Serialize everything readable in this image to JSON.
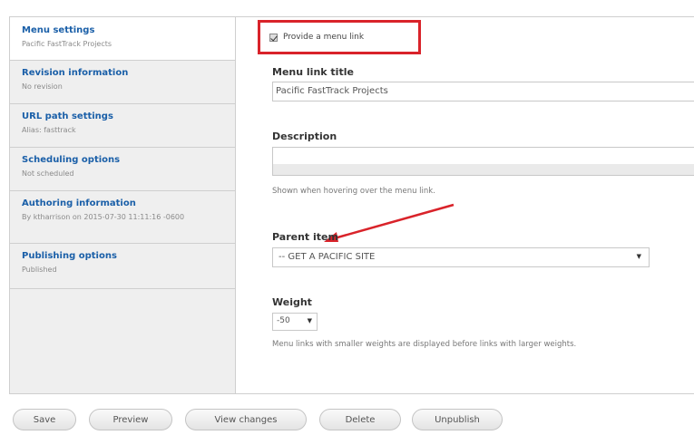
{
  "sidebar": {
    "tabs": [
      {
        "title": "Menu settings",
        "summary": "Pacific FastTrack Projects"
      },
      {
        "title": "Revision information",
        "summary": "No revision"
      },
      {
        "title": "URL path settings",
        "summary": "Alias: fasttrack"
      },
      {
        "title": "Scheduling options",
        "summary": "Not scheduled"
      },
      {
        "title": "Authoring information",
        "summary": "By ktharrison on 2015-07-30 11:11:16 -0600"
      },
      {
        "title": "Publishing options",
        "summary": "Published"
      }
    ]
  },
  "menu": {
    "provide_link_label": "Provide a menu link",
    "provide_link_checked": true,
    "link_title_label": "Menu link title",
    "link_title_value": "Pacific FastTrack Projects",
    "description_label": "Description",
    "description_value": "",
    "description_help": "Shown when hovering over the menu link.",
    "parent_label": "Parent item",
    "parent_value": "-- GET A PACIFIC SITE",
    "weight_label": "Weight",
    "weight_value": "-50",
    "weight_help": "Menu links with smaller weights are displayed before links with larger weights."
  },
  "buttons": {
    "save": "Save",
    "preview": "Preview",
    "view_changes": "View changes",
    "delete": "Delete",
    "unpublish": "Unpublish"
  },
  "colors": {
    "annotation_red": "#d9232a",
    "tab_title_blue": "#1a5fa8"
  }
}
